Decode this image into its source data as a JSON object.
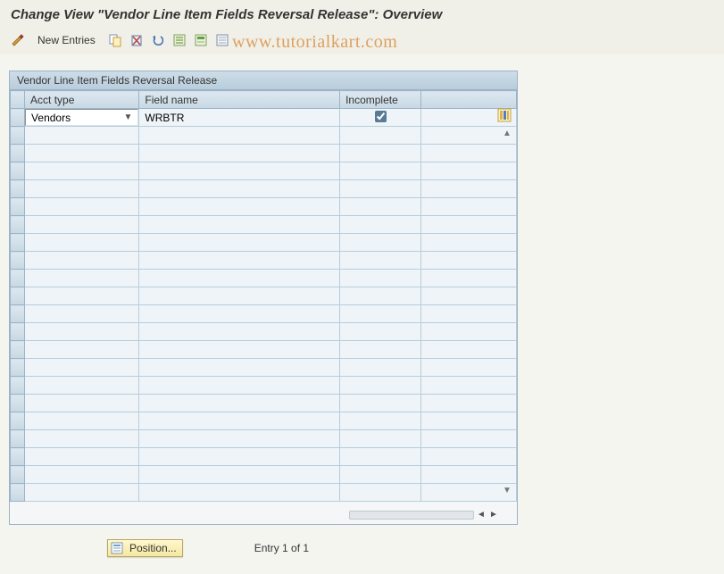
{
  "header": {
    "title": "Change View \"Vendor Line Item Fields Reversal Release\": Overview"
  },
  "toolbar": {
    "new_entries_label": "New Entries"
  },
  "watermark": "www.tutorialkart.com",
  "panel": {
    "title": "Vendor Line Item Fields Reversal Release",
    "columns": {
      "acct_type": "Acct type",
      "field_name": "Field name",
      "incomplete": "Incomplete"
    },
    "rows": [
      {
        "acct_type": "Vendors",
        "field_name": "WRBTR",
        "incomplete": true
      }
    ],
    "empty_rows": 21
  },
  "footer": {
    "position_label": "Position...",
    "entry_text": "Entry 1 of 1"
  }
}
